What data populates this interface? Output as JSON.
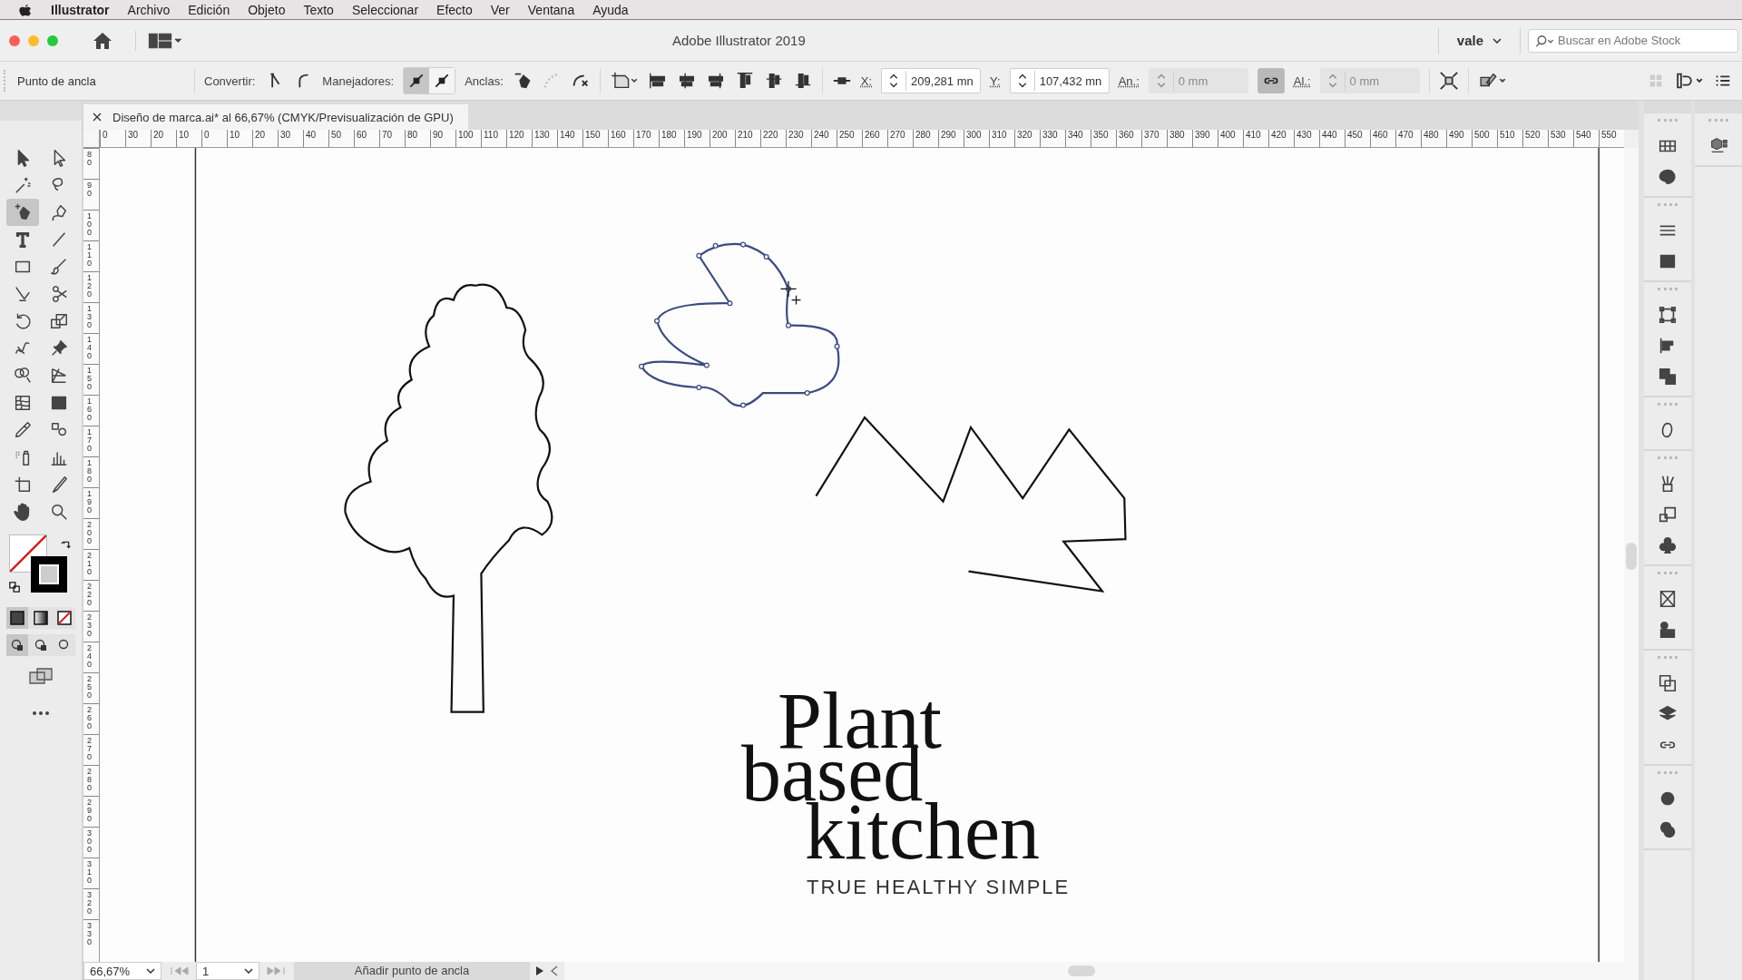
{
  "menu_bar": {
    "app": "Illustrator",
    "items": [
      "Archivo",
      "Edición",
      "Objeto",
      "Texto",
      "Seleccionar",
      "Efecto",
      "Ver",
      "Ventana",
      "Ayuda"
    ]
  },
  "app_bar": {
    "title": "Adobe Illustrator 2019",
    "workspace": "vale",
    "search": {
      "placeholder": "Buscar en Adobe Stock"
    }
  },
  "control_bar": {
    "selection": "Punto de ancla",
    "convert_label": "Convertir:",
    "handles_label": "Manejadores:",
    "handles": [
      {
        "selected": true
      },
      {
        "selected": false
      }
    ],
    "anchors_label": "Anclas:",
    "x": {
      "label": "X:",
      "value": "209,281 mn",
      "disabled": false
    },
    "y": {
      "label": "Y:",
      "value": "107,432 mn",
      "disabled": false
    },
    "width": {
      "label": "An.:",
      "value": "0 mm",
      "disabled": true
    },
    "link": {
      "on": true
    },
    "height": {
      "label": "Al.:",
      "value": "0 mm",
      "disabled": true
    }
  },
  "document_tab": {
    "title": "Diseño de marca.ai* al 66,67% (CMYK/Previsualización de GPU)"
  },
  "tools": [
    {
      "selected": false
    },
    {
      "selected": false
    },
    {
      "selected": false
    },
    {
      "selected": false
    },
    {
      "selected": true
    },
    {
      "selected": false
    },
    {
      "selected": false
    },
    {
      "selected": false
    },
    {
      "selected": false
    },
    {
      "selected": false
    },
    {
      "selected": false
    },
    {
      "selected": false
    },
    {
      "selected": false
    },
    {
      "selected": false
    },
    {
      "selected": false
    },
    {
      "selected": false
    },
    {
      "selected": false
    },
    {
      "selected": false
    },
    {
      "selected": false
    },
    {
      "selected": false
    },
    {
      "selected": false
    },
    {
      "selected": false
    },
    {
      "selected": false
    },
    {
      "selected": false
    },
    {
      "selected": false
    },
    {
      "selected": false
    },
    {
      "selected": false
    },
    {
      "selected": false
    }
  ],
  "color_modes": [
    {
      "selected": true
    },
    {
      "selected": false
    },
    {
      "selected": false
    }
  ],
  "draw_modes": [
    {
      "selected": true
    },
    {
      "selected": false
    },
    {
      "selected": false
    }
  ],
  "rulers": {
    "horizontal": [
      "0",
      "30",
      "20",
      "10",
      "0",
      "10",
      "20",
      "30",
      "40",
      "50",
      "60",
      "70",
      "80",
      "90",
      "100",
      "110",
      "120",
      "130",
      "140",
      "150",
      "160",
      "170",
      "180",
      "190",
      "200",
      "210",
      "220",
      "230",
      "240",
      "250",
      "260",
      "270",
      "280",
      "290",
      "300",
      "310",
      "320",
      "330",
      "340",
      "350",
      "360",
      "370",
      "380",
      "390",
      "400",
      "410",
      "420",
      "430",
      "440",
      "450",
      "460",
      "470",
      "480",
      "490",
      "500",
      "510",
      "520",
      "530",
      "540",
      "550"
    ],
    "vertical": [
      "80",
      "90",
      "100",
      "110",
      "120",
      "130",
      "140",
      "150",
      "160",
      "170",
      "180",
      "190",
      "200",
      "210",
      "220",
      "230",
      "240",
      "250",
      "260",
      "270",
      "280",
      "290",
      "300",
      "310",
      "320",
      "330"
    ]
  },
  "artboard": {
    "lines": [
      "Plant",
      "based",
      "kitchen"
    ],
    "tagline": "TRUE HEALTHY SIMPLE"
  },
  "status_bar": {
    "zoom": "66,67%",
    "artboard": "1",
    "tool_hint": "Añadir punto de ancla"
  }
}
